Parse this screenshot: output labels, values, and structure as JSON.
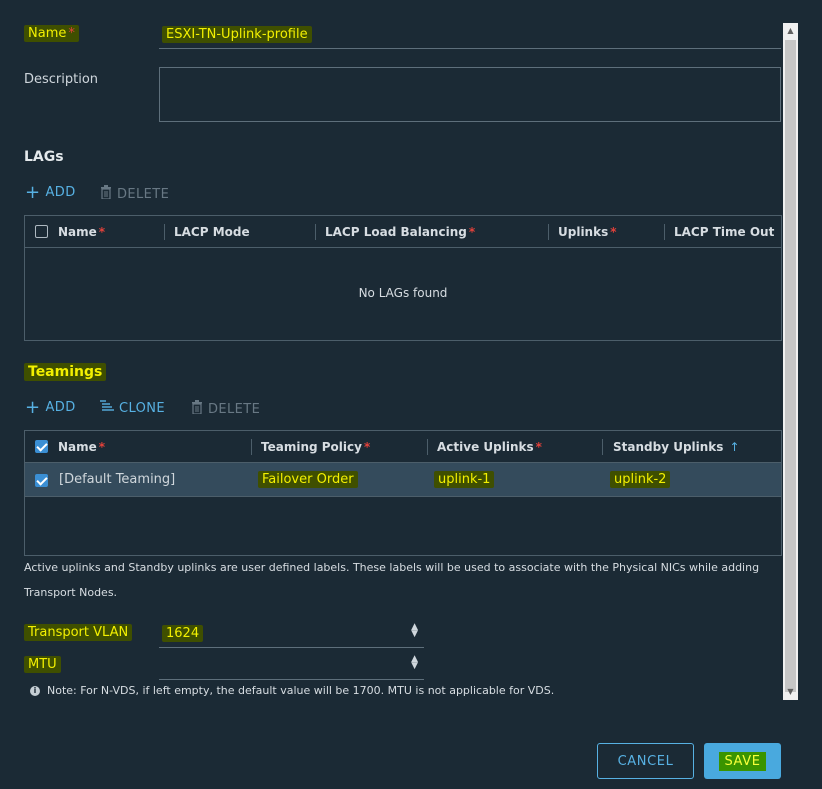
{
  "form": {
    "name_label": "Name",
    "name_value": "ESXI-TN-Uplink-profile",
    "description_label": "Description"
  },
  "lags": {
    "title": "LAGs",
    "add_label": "ADD",
    "delete_label": "DELETE",
    "columns": [
      "Name",
      "LACP Mode",
      "LACP Load Balancing",
      "Uplinks",
      "LACP Time Out"
    ],
    "empty_text": "No LAGs found"
  },
  "teamings": {
    "title": "Teamings",
    "add_label": "ADD",
    "clone_label": "CLONE",
    "delete_label": "DELETE",
    "columns": [
      "Name",
      "Teaming Policy",
      "Active Uplinks",
      "Standby Uplinks"
    ],
    "rows": [
      {
        "name": "[Default Teaming]",
        "policy": "Failover Order",
        "active": "uplink-1",
        "standby": "uplink-2",
        "selected": true
      }
    ],
    "info": "Active uplinks and Standby uplinks are user defined labels. These labels will be used to associate with the Physical NICs while adding Transport Nodes."
  },
  "transport_vlan": {
    "label": "Transport VLAN",
    "value": "1624"
  },
  "mtu": {
    "label": "MTU",
    "value": "",
    "note": "Note: For N-VDS, if left empty, the default value will be 1700. MTU is not applicable for VDS."
  },
  "buttons": {
    "cancel": "CANCEL",
    "save": "SAVE"
  },
  "colors": {
    "accent": "#57b1e3",
    "background": "#1b2a35",
    "required": "#e3413a",
    "highlight": "#f3f000"
  }
}
